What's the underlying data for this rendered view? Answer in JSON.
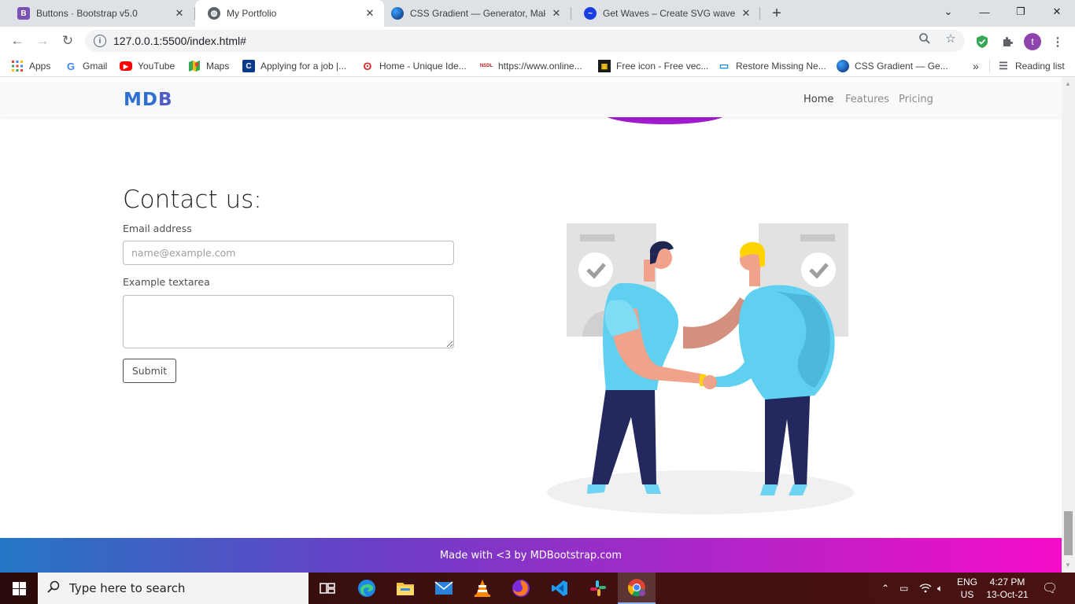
{
  "tabs": [
    {
      "title": "Buttons · Bootstrap v5.0",
      "favicon": "bootstrap-icon",
      "color": "#7952b3"
    },
    {
      "title": "My Portfolio",
      "favicon": "globe-icon",
      "color": "#5f6368"
    },
    {
      "title": "CSS Gradient — Generator, Make",
      "favicon": "cssgradient-icon",
      "color": "#0b3c8c"
    },
    {
      "title": "Get Waves – Create SVG waves fo",
      "favicon": "getwaves-icon",
      "color": "#1a3fe0"
    }
  ],
  "address_bar": {
    "url": "127.0.0.1:5500/index.html#"
  },
  "bookmarks": [
    {
      "label": "Apps",
      "icon": "apps-grid-icon"
    },
    {
      "label": "Gmail",
      "icon": "google-icon"
    },
    {
      "label": "YouTube",
      "icon": "youtube-icon"
    },
    {
      "label": "Maps",
      "icon": "maps-icon"
    },
    {
      "label": "Applying for a job |...",
      "icon": "c-icon"
    },
    {
      "label": "Home - Unique Ide...",
      "icon": "fingerprint-icon"
    },
    {
      "label": "https://www.online...",
      "icon": "nsdl-icon"
    },
    {
      "label": "Free icon - Free vec...",
      "icon": "freeicon-icon"
    },
    {
      "label": "Restore Missing Ne...",
      "icon": "monitor-icon"
    },
    {
      "label": "CSS Gradient — Ge...",
      "icon": "cssgradient-icon"
    }
  ],
  "bookmarks_overflow": "»",
  "reading_list": "Reading list",
  "page": {
    "brand": {
      "a": "MD",
      "b": "B"
    },
    "nav": [
      {
        "label": "Home",
        "active": true
      },
      {
        "label": "Features",
        "active": false
      },
      {
        "label": "Pricing",
        "active": false
      }
    ],
    "contact": {
      "title": "Contact us:",
      "email_label": "Email address",
      "email_placeholder": "name@example.com",
      "email_value": "",
      "textarea_label": "Example textarea",
      "textarea_value": "",
      "submit_label": "Submit"
    },
    "footer": "Made with <3 by MDBootstrap.com",
    "footer_gradient": [
      "#2477c4",
      "#f50cc9"
    ]
  },
  "taskbar": {
    "search_placeholder": "Type here to search",
    "apps": [
      "task-view-icon",
      "edge-icon",
      "file-explorer-icon",
      "mail-icon",
      "vlc-icon",
      "firefox-icon",
      "vscode-icon",
      "slack-icon",
      "chrome-icon"
    ],
    "lang_line1": "ENG",
    "lang_line2": "US",
    "time": "4:27 PM",
    "date": "13-Oct-21"
  }
}
